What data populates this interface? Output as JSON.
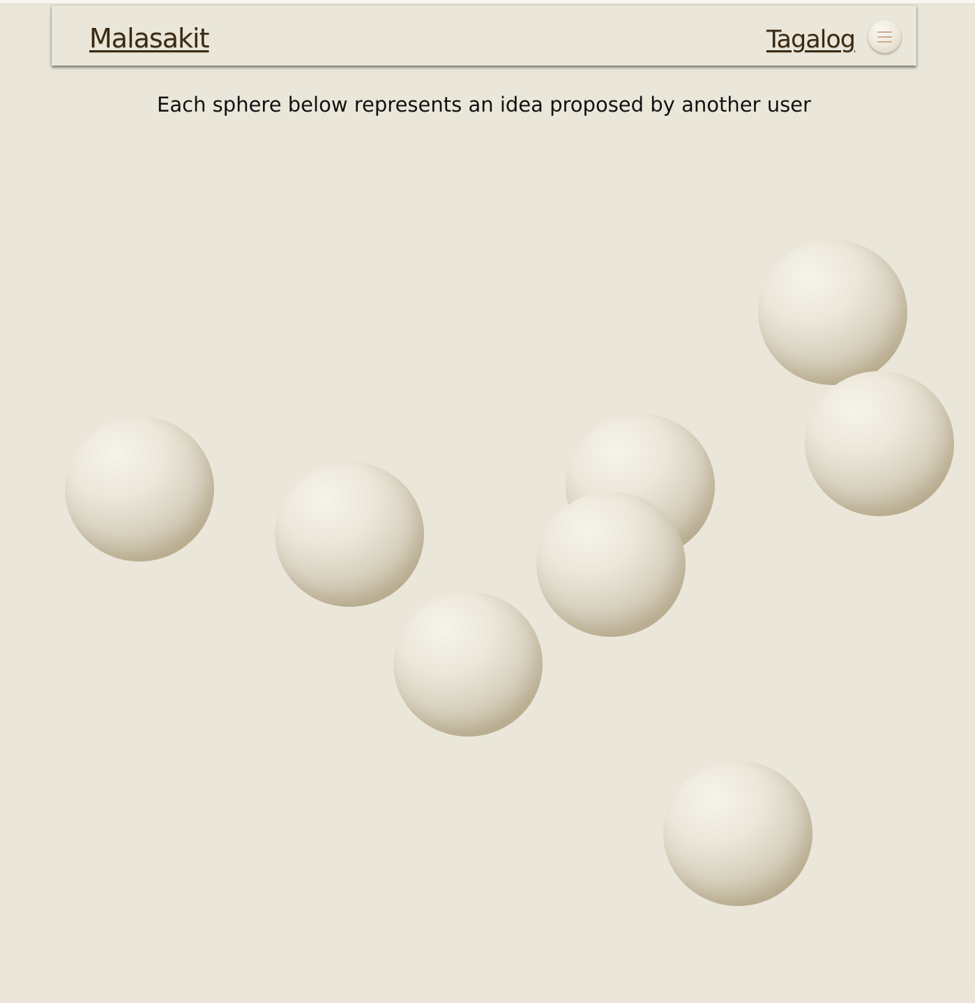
{
  "header": {
    "brand": "Malasakit",
    "language": "Tagalog",
    "menu_icon": "hamburger-menu-icon"
  },
  "main": {
    "subtitle": "Each sphere below represents an idea proposed by another user"
  },
  "colors": {
    "background": "#eae7da",
    "link": "#3c2a12",
    "sphere": "#ece7da"
  }
}
